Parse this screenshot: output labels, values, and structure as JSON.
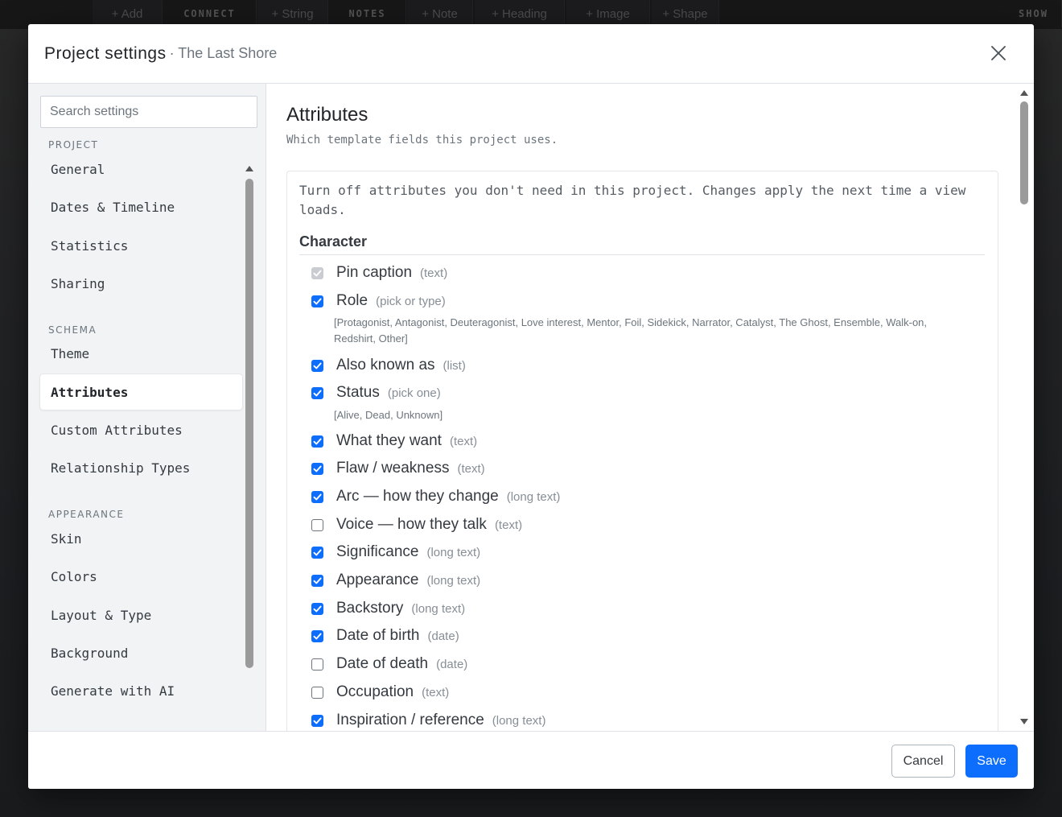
{
  "background_toolbar": {
    "items": [
      "+ Add",
      "CONNECT",
      "+ String",
      "NOTES",
      "+ Note",
      "+ Heading",
      "+ Image",
      "+ Shape",
      "SHOW"
    ]
  },
  "modal": {
    "title": "Project settings",
    "subtitle": "· The Last Shore",
    "close_icon": "close-icon"
  },
  "sidebar": {
    "search_placeholder": "Search settings",
    "sections": [
      {
        "label": "PROJECT",
        "items": [
          "General",
          "Dates & Timeline",
          "Statistics",
          "Sharing"
        ]
      },
      {
        "label": "SCHEMA",
        "items": [
          "Theme",
          "Attributes",
          "Custom Attributes",
          "Relationship Types"
        ]
      },
      {
        "label": "APPEARANCE",
        "items": [
          "Skin",
          "Colors",
          "Layout & Type",
          "Background",
          "Generate with AI"
        ]
      }
    ],
    "active_item": "Attributes"
  },
  "content": {
    "title": "Attributes",
    "description": "Which template fields this project uses.",
    "note": "Turn off attributes you don't need in this project. Changes apply the next time a view loads.",
    "group_title": "Character",
    "attributes": [
      {
        "name": "Pin caption",
        "type": "(text)",
        "checked": true,
        "disabled": true
      },
      {
        "name": "Role",
        "type": "(pick or type)",
        "checked": true,
        "options": "[Protagonist, Antagonist, Deuteragonist, Love interest, Mentor, Foil, Sidekick, Narrator, Catalyst, The Ghost, Ensemble, Walk-on, Redshirt, Other]"
      },
      {
        "name": "Also known as",
        "type": "(list)",
        "checked": true
      },
      {
        "name": "Status",
        "type": "(pick one)",
        "checked": true,
        "options": "[Alive, Dead, Unknown]"
      },
      {
        "name": "What they want",
        "type": "(text)",
        "checked": true
      },
      {
        "name": "Flaw / weakness",
        "type": "(text)",
        "checked": true
      },
      {
        "name": "Arc — how they change",
        "type": "(long text)",
        "checked": true
      },
      {
        "name": "Voice — how they talk",
        "type": "(text)",
        "checked": false
      },
      {
        "name": "Significance",
        "type": "(long text)",
        "checked": true
      },
      {
        "name": "Appearance",
        "type": "(long text)",
        "checked": true
      },
      {
        "name": "Backstory",
        "type": "(long text)",
        "checked": true
      },
      {
        "name": "Date of birth",
        "type": "(date)",
        "checked": true
      },
      {
        "name": "Date of death",
        "type": "(date)",
        "checked": false
      },
      {
        "name": "Occupation",
        "type": "(text)",
        "checked": false
      },
      {
        "name": "Inspiration / reference",
        "type": "(long text)",
        "checked": true
      }
    ]
  },
  "footer": {
    "cancel_label": "Cancel",
    "save_label": "Save"
  },
  "colors": {
    "accent": "#0d6efd",
    "sidebar_bg": "#f1f3f5",
    "border": "#dee2e6"
  }
}
